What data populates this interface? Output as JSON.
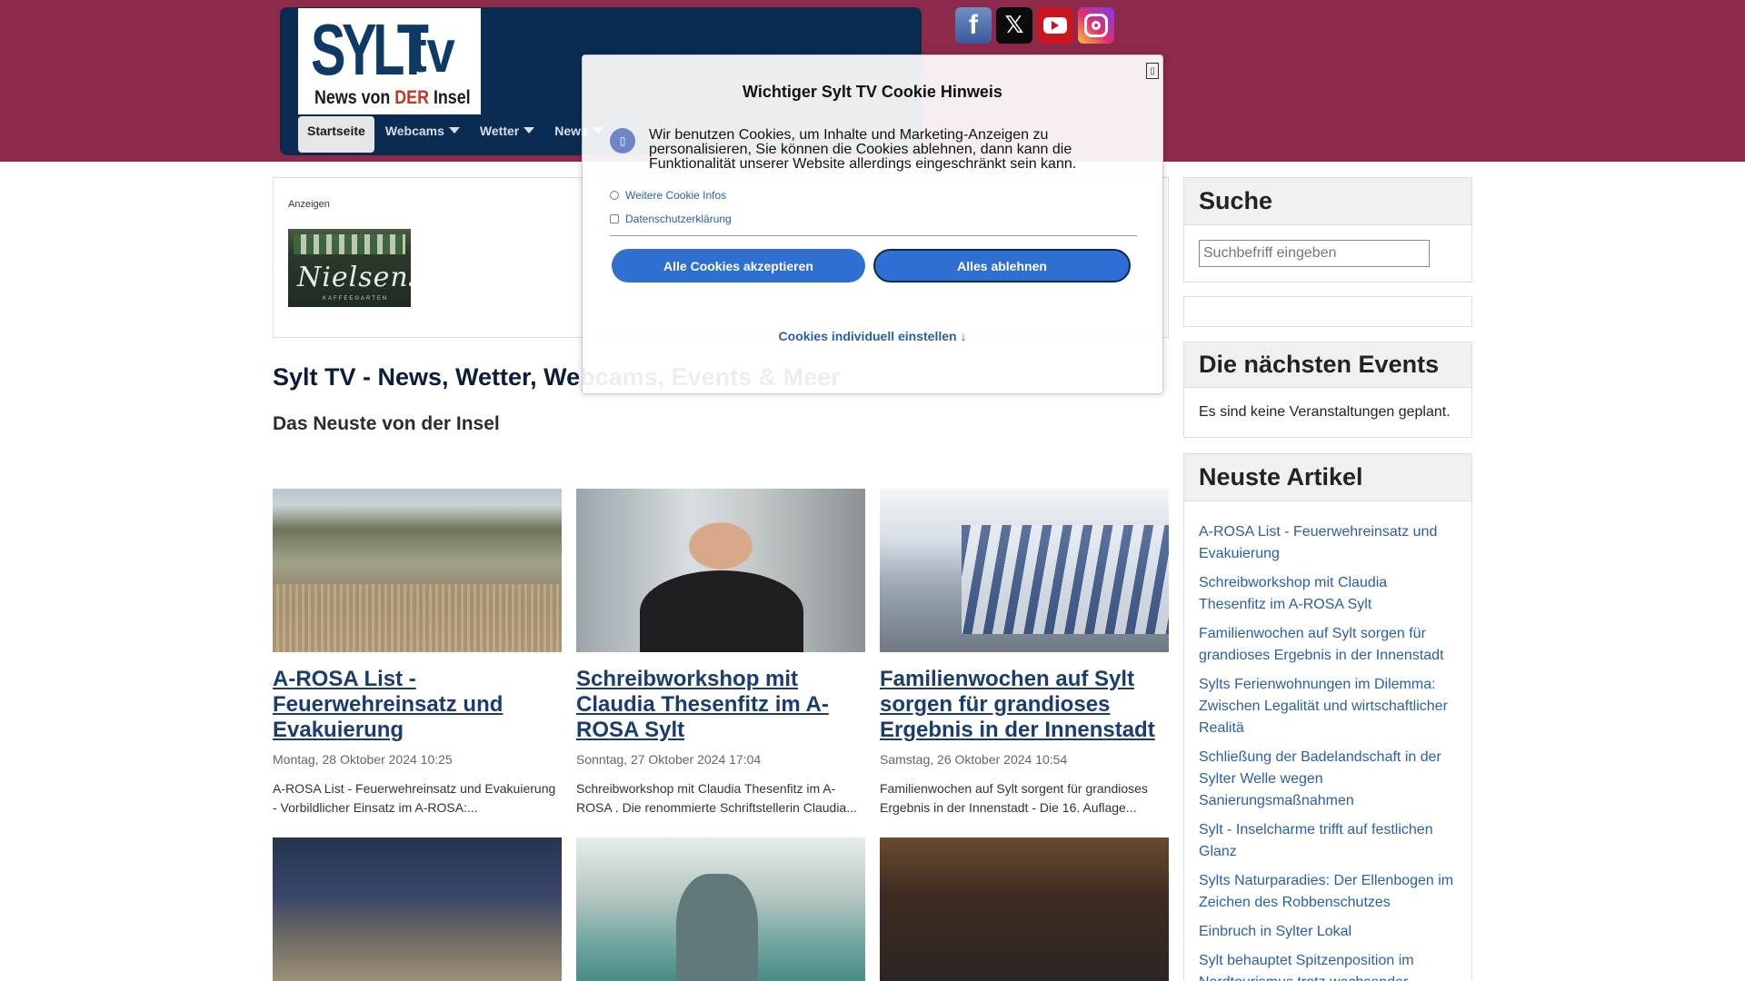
{
  "header": {
    "logo": {
      "brand": "SYLT",
      "suffix": "tv",
      "tagline_pre": "News von ",
      "tagline_em": "DER",
      "tagline_post": " Insel"
    },
    "nav": [
      {
        "label": "Startseite",
        "active": true,
        "dropdown": false
      },
      {
        "label": "Webcams",
        "active": false,
        "dropdown": true
      },
      {
        "label": "Wetter",
        "active": false,
        "dropdown": true
      },
      {
        "label": "News",
        "active": false,
        "dropdown": true
      }
    ],
    "social": [
      {
        "icon": "facebook-icon",
        "glyph": "f"
      },
      {
        "icon": "x-icon",
        "glyph": "𝕏"
      },
      {
        "icon": "youtube-icon",
        "glyph": ""
      },
      {
        "icon": "instagram-icon",
        "glyph": ""
      }
    ]
  },
  "ads": {
    "label": "Anzeigen",
    "ad_script": "Nielsens",
    "ad_sub": "KAFFEEGARTEN"
  },
  "main": {
    "page_title": "Sylt TV - News, Wetter, Webcams, Events & Meer",
    "section_title": "Das Neuste von der Insel",
    "articles": [
      {
        "title": "A-ROSA List - Feuerwehreinsatz und Evakuierung",
        "date": "Montag, 28 Oktober 2024 10:25",
        "teaser": "A-ROSA List - Feuerwehreinsatz und Evakuierung - Vorbildlicher Einsatz im A-ROSA:..."
      },
      {
        "title": "Schreibworkshop mit Claudia Thesenfitz im A-ROSA Sylt",
        "date": "Sonntag, 27 Oktober 2024 17:04",
        "teaser": "Schreibworkshop mit Claudia Thesenfitz im A-ROSA . Die renommierte Schriftstellerin Claudia..."
      },
      {
        "title": "Familienwochen auf Sylt sorgen für grandioses Ergebnis in der Innenstadt",
        "date": "Samstag, 26 Oktober 2024 10:54",
        "teaser": " Familienwochen auf Sylt sorgent für grandioses Ergebnis in der Innenstadt - Die 16. Auflage..."
      }
    ]
  },
  "sidebar": {
    "search": {
      "title": "Suche",
      "placeholder": "Suchbefriff eingeben"
    },
    "events": {
      "title": "Die nächsten Events",
      "empty": "Es sind keine Veranstaltungen geplant."
    },
    "latest": {
      "title": "Neuste Artikel",
      "items": [
        "A-ROSA List - Feuerwehreinsatz und Evakuierung",
        "Schreibworkshop mit Claudia Thesenfitz im A-ROSA Sylt",
        "Familienwochen auf Sylt sorgen für grandioses Ergebnis in der Innenstadt",
        "Sylts Ferienwohnungen im Dilemma: Zwischen Legalität und wirtschaftlicher Realitä",
        "Schließung der Badelandschaft in der Sylter Welle wegen Sanierungsmaßnahmen",
        "Sylt - Inselcharme trifft auf festlichen Glanz",
        "Sylts Naturparadies: Der Ellenbogen im Zeichen des Robbenschutzes",
        "Einbruch in Sylter Lokal",
        "Sylt behauptet Spitzenposition im Nordtourismus trotz wachsender"
      ]
    }
  },
  "cookie": {
    "title": "Wichtiger Sylt TV Cookie Hinweis",
    "close": "▯",
    "badge": "▯",
    "text": "Wir benutzen Cookies, um Inhalte und Marketing-Anzeigen zu personalisieren, Sie können die  Cookies ablehnen, dann kann die Funktionalität unserer Website allerdings eingeschränkt sein kann.",
    "link_more": "Weitere Cookie Infos",
    "link_privacy": "Datenschutzerklärung",
    "accept": "Alle Cookies akzeptieren",
    "reject": "Alles ablehnen",
    "individual": "Cookies individuell einstellen ↓"
  },
  "colors": {
    "header_band": "#8d2a4b",
    "header_box": "#0a2c52",
    "link": "#2b5ea8",
    "button": "#2f6fd1"
  }
}
